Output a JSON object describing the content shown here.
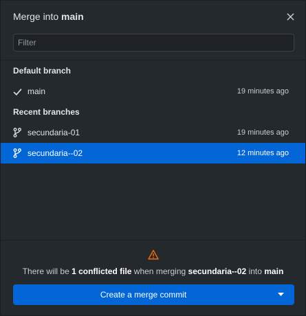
{
  "header": {
    "title_prefix": "Merge into",
    "title_branch": "main"
  },
  "filter": {
    "placeholder": "Filter",
    "value": ""
  },
  "default_section": {
    "heading": "Default branch",
    "items": [
      {
        "name": "main",
        "time": "19 minutes ago",
        "icon": "check-icon"
      }
    ]
  },
  "recent_section": {
    "heading": "Recent branches",
    "items": [
      {
        "name": "secundaria-01",
        "time": "19 minutes ago",
        "icon": "branch-icon",
        "selected": false
      },
      {
        "name": "secundaria--02",
        "time": "12 minutes ago",
        "icon": "branch-icon",
        "selected": true
      }
    ]
  },
  "footer": {
    "warning_icon": "warning-icon",
    "msg_part1": "There will be",
    "msg_conflict": "1 conflicted file",
    "msg_part2": "when merging",
    "msg_source": "secundaria--02",
    "msg_part3": "into",
    "msg_target": "main",
    "button_label": "Create a merge commit"
  },
  "colors": {
    "accent": "#0366d6",
    "background": "#24292e",
    "warning": "#f66a0a"
  }
}
